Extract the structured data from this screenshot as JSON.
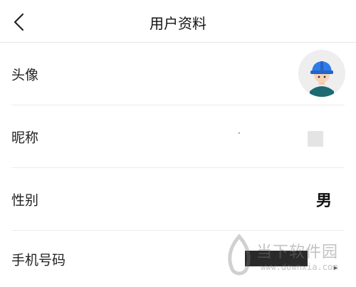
{
  "header": {
    "title": "用户资料",
    "back_icon": "chevron-left-icon"
  },
  "rows": {
    "avatar": {
      "label": "头像",
      "icon": "user-avatar-worker-helmet-icon"
    },
    "nickname": {
      "label": "昵称",
      "value": ""
    },
    "gender": {
      "label": "性别",
      "value": "男"
    },
    "phone": {
      "label": "手机号码",
      "value": ""
    }
  },
  "watermark": {
    "text": "当下软件园",
    "url": "www.downxia.com"
  },
  "colors": {
    "helmet": "#2f7bea",
    "divider": "#ececec",
    "background": "#ffffff"
  }
}
